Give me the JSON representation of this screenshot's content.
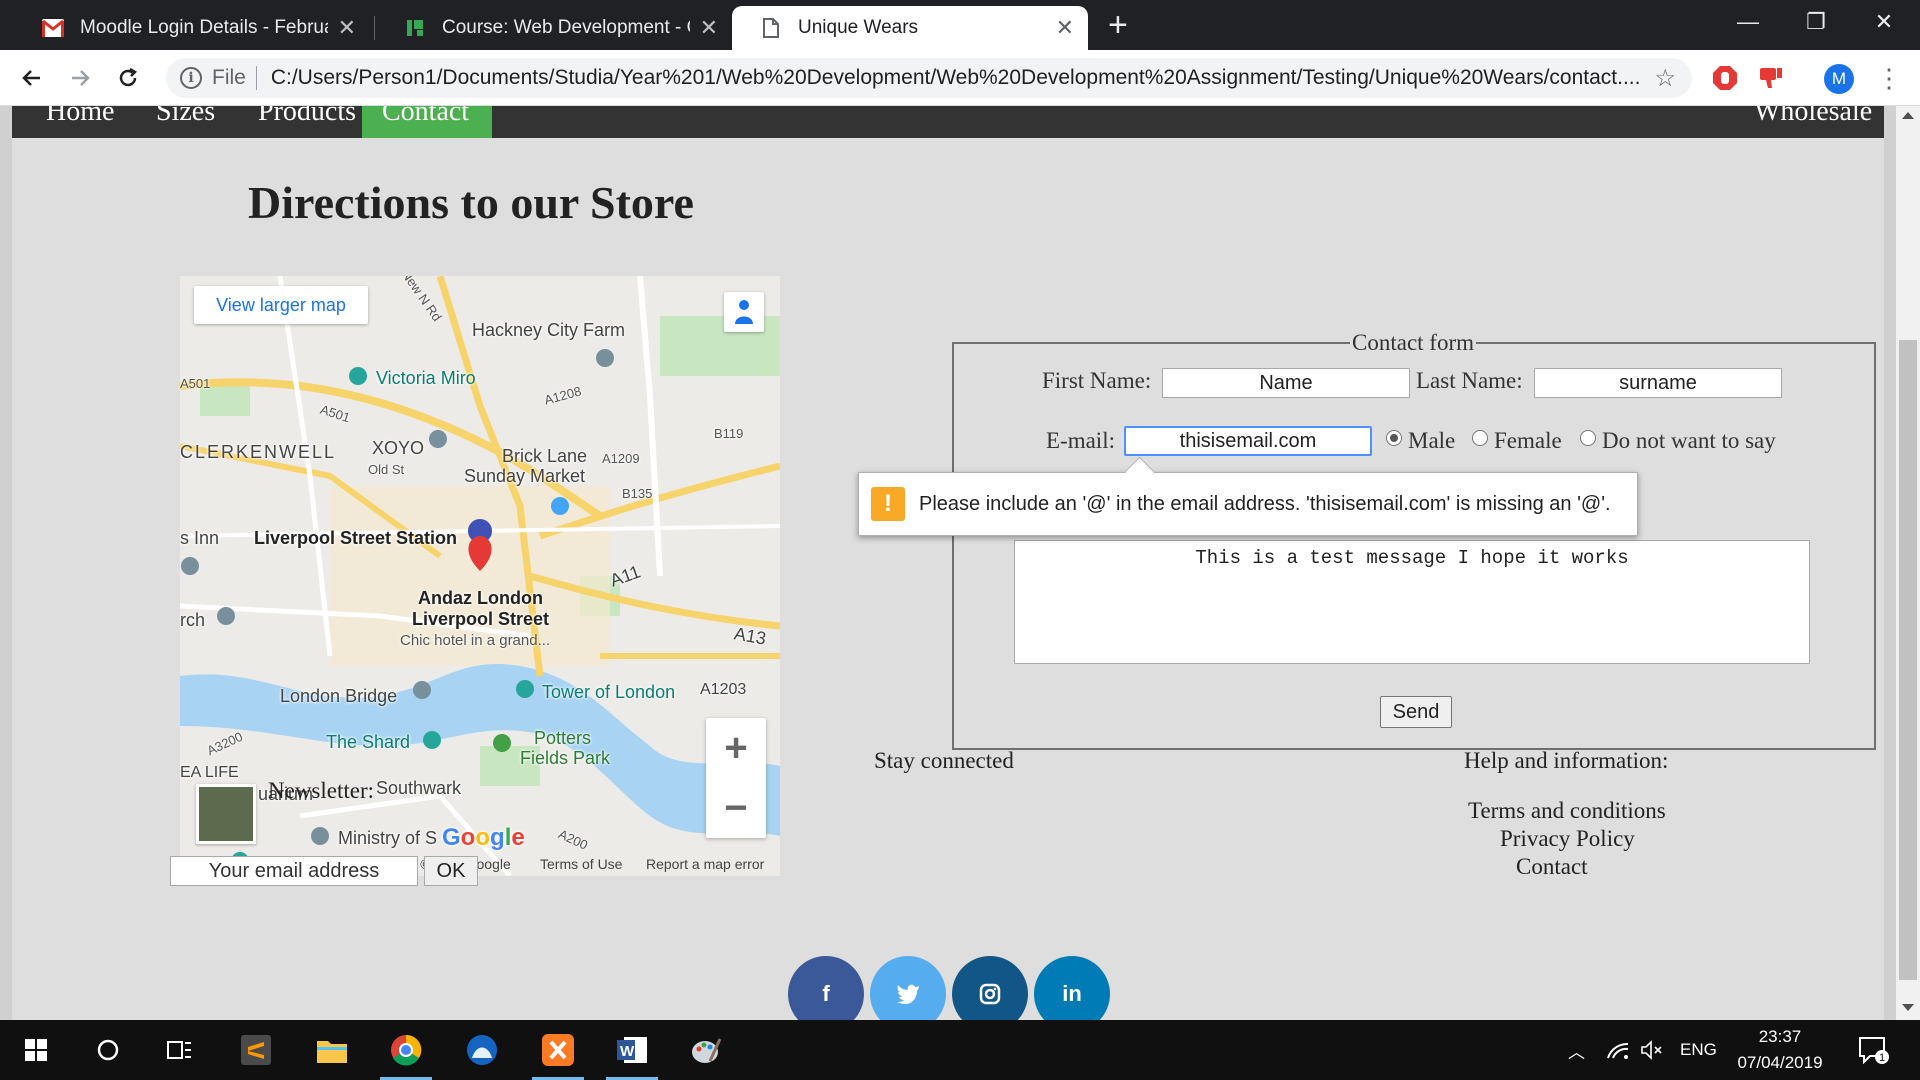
{
  "browser": {
    "tabs": [
      {
        "title": "Moodle Login Details - February",
        "icon": "gmail-icon",
        "active": false
      },
      {
        "title": "Course: Web Development - QAC",
        "icon": "moodle-icon",
        "active": false
      },
      {
        "title": "Unique Wears",
        "icon": "page-icon",
        "active": true
      }
    ],
    "url_scheme_label": "File",
    "url": "C:/Users/Person1/Documents/Studia/Year%201/Web%20Development/Web%20Development%20Assignment/Testing/Unique%20Wears/contact....",
    "profile_initial": "M"
  },
  "site": {
    "nav": [
      {
        "label": "Home",
        "active": false
      },
      {
        "label": "Sizes",
        "active": false
      },
      {
        "label": "Products",
        "active": false
      },
      {
        "label": "Contact",
        "active": true
      },
      {
        "label": "Wholesale",
        "active": false
      }
    ]
  },
  "page": {
    "title": "Directions to our Store"
  },
  "map": {
    "view_larger": "View larger map",
    "labels": {
      "hackney": "Hackney City Farm",
      "victoria": "Victoria Miro",
      "xoyo": "XOYO",
      "a501": "A501",
      "a501b": "A501",
      "clerkenwell": "CLERKENWELL",
      "bricklane": "Brick Lane",
      "sunday": "Sunday Market",
      "inn": "s Inn",
      "liverpool": "Liverpool Street Station",
      "andaz1": "Andaz London",
      "andaz2": "Liverpool Street",
      "andaz3": "Chic hotel in a grand...",
      "a11": "A11",
      "a13": "A13",
      "rch": "rch",
      "londonbridge": "London Bridge",
      "tower": "Tower of London",
      "a1203": "A1203",
      "shard": "The Shard",
      "potters1": "Potters",
      "potters2": "Fields Park",
      "southwark": "Southwark",
      "uarium": "uarium",
      "ministry": "Ministry of S",
      "ealife": "EA LIFE",
      "a1208": "A1208",
      "a1209": "A1209",
      "b119": "B119",
      "b135": "B135",
      "a3200": "A3200",
      "a200": "A200",
      "newnrd": "New N Rd",
      "oldst": "Old St"
    },
    "zoom_in": "+",
    "zoom_out": "−",
    "google": "Google",
    "footer_data": "Map data ©2019 Google",
    "footer_terms": "Terms of Use",
    "footer_report": "Report a map error"
  },
  "form": {
    "legend": "Contact form",
    "first_name_label": "First Name:",
    "first_name_value": "Name",
    "last_name_label": "Last Name:",
    "last_name_value": "surname",
    "email_label": "E-mail:",
    "email_value": "thisisemail.com",
    "gender_options": [
      "Male",
      "Female",
      "Do not want to say"
    ],
    "gender_selected": "Male",
    "message_value": "This is a test message I hope it works",
    "send_label": "Send",
    "validation_message": "Please include an '@' in the email address. 'thisisemail.com' is missing an '@'."
  },
  "footer": {
    "newsletter_label": "Newsletter:",
    "newsletter_value": "Your email address",
    "ok_label": "OK",
    "stay_connected": "Stay connected",
    "social": [
      {
        "name": "facebook",
        "glyph": "f",
        "color": "#3b5998"
      },
      {
        "name": "twitter",
        "glyph": "t",
        "color": "#1da1f2"
      },
      {
        "name": "instagram",
        "glyph": "◎",
        "color": "#125688"
      },
      {
        "name": "linkedin",
        "glyph": "in",
        "color": "#007bb5"
      }
    ],
    "help_title": "Help and information:",
    "terms": "Terms and conditions",
    "privacy": "Privacy Policy",
    "contact_cut": "Contact"
  },
  "taskbar": {
    "language": "ENG",
    "time": "23:37",
    "date": "07/04/2019",
    "notifications": "1"
  }
}
